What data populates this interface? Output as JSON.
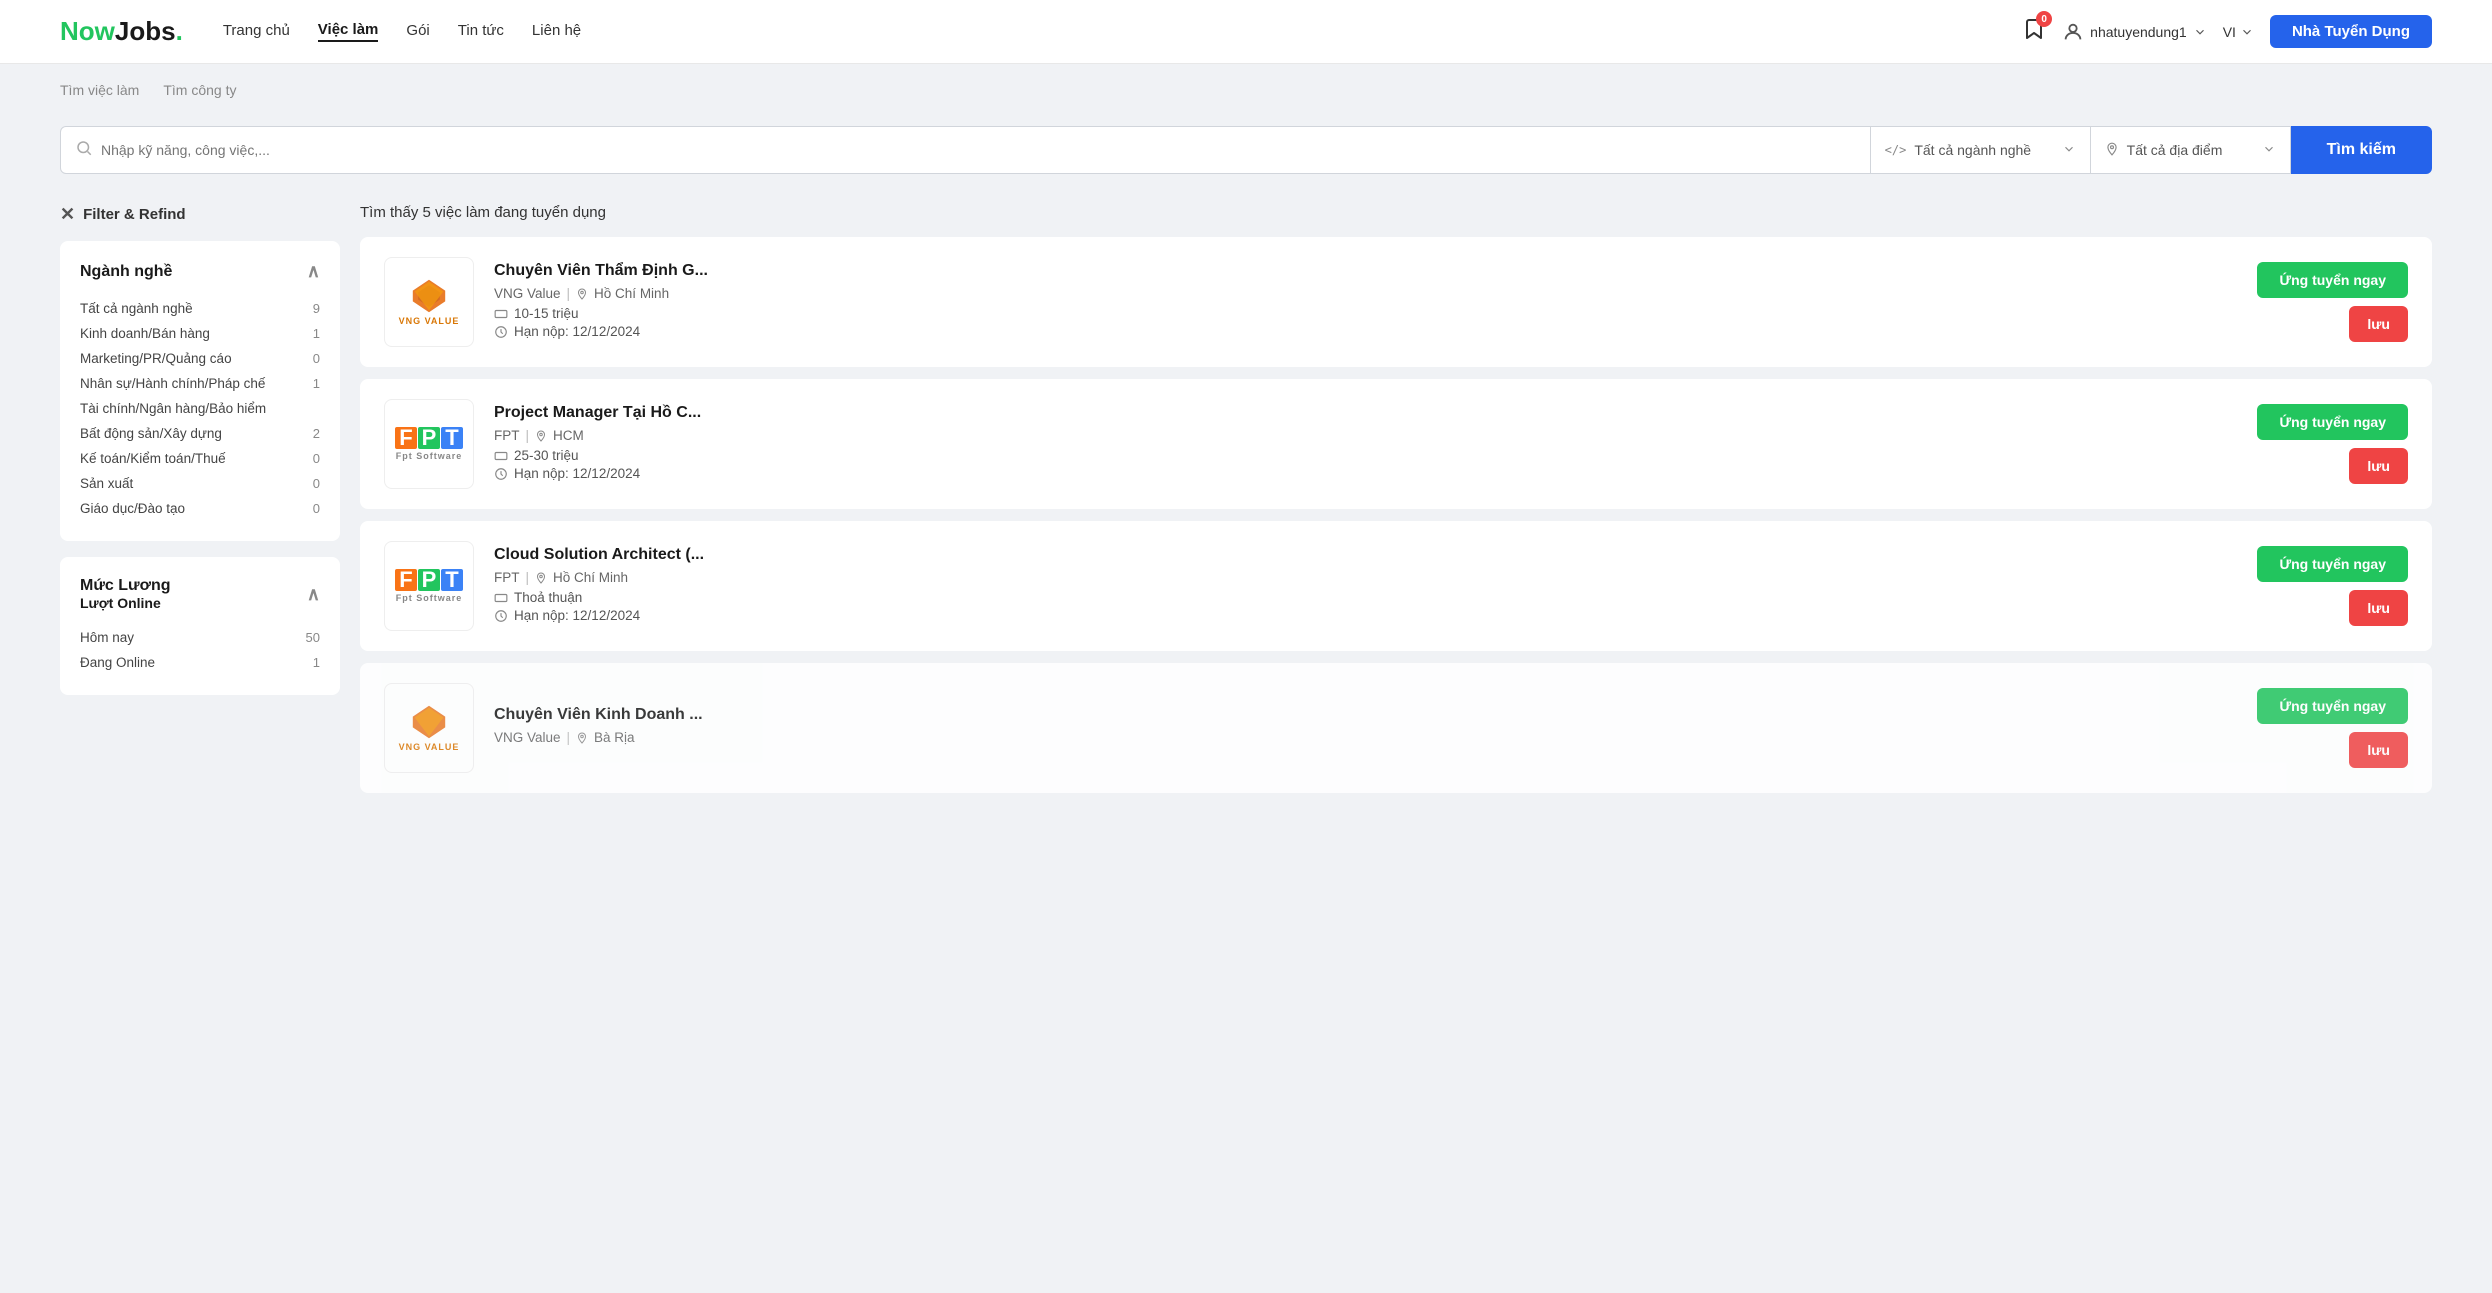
{
  "header": {
    "logo_now": "Now",
    "logo_jobs": "Jobs",
    "logo_dot": ".",
    "nav": [
      {
        "label": "Trang chủ",
        "active": false
      },
      {
        "label": "Việc làm",
        "active": true
      },
      {
        "label": "Gói",
        "active": false
      },
      {
        "label": "Tin tức",
        "active": false
      },
      {
        "label": "Liên hệ",
        "active": false
      }
    ],
    "badge_count": "0",
    "user_name": "nhatuyendung1",
    "lang": "VI",
    "btn_employer": "Nhà Tuyển Dụng"
  },
  "subnav": [
    {
      "label": "Tìm việc làm",
      "active": true
    },
    {
      "label": "Tìm công ty",
      "active": false
    }
  ],
  "search": {
    "input_placeholder": "Nhập kỹ năng, công việc,...",
    "industry_label": "Tất cả ngành nghề",
    "location_label": "Tất cả địa điểm",
    "btn_label": "Tìm kiếm"
  },
  "filter": {
    "title": "Filter & Refind",
    "industry_section": {
      "title": "Ngành nghề",
      "items": [
        {
          "label": "Tất cả ngành nghề",
          "count": "9"
        },
        {
          "label": "Kinh doanh/Bán hàng",
          "count": "1"
        },
        {
          "label": "Marketing/PR/Quảng cáo",
          "count": "0"
        },
        {
          "label": "Nhân sự/Hành chính/Pháp chế",
          "count": "1"
        },
        {
          "label": "Tài chính/Ngân hàng/Bảo hiểm",
          "count": ""
        },
        {
          "label": "Bất động sản/Xây dựng",
          "count": "2"
        },
        {
          "label": "Kế toán/Kiểm toán/Thuế",
          "count": "0"
        },
        {
          "label": "Sản xuất",
          "count": "0"
        },
        {
          "label": "Giáo dục/Đào tạo",
          "count": "0"
        }
      ]
    },
    "salary_section": {
      "title": "Mức Lương",
      "subtitle": "Lượt Online",
      "items": [
        {
          "label": "Hôm nay",
          "count": "50"
        },
        {
          "label": "Đang Online",
          "count": "1"
        }
      ]
    }
  },
  "jobs": {
    "count_text": "Tìm thấy 5 việc làm đang tuyển dụng",
    "list": [
      {
        "id": 1,
        "title": "Chuyên Viên Thẩm Định G...",
        "company": "VNG Value",
        "location": "Hồ Chí Minh",
        "salary": "10-15 triệu",
        "deadline": "Hạn nộp: 12/12/2024",
        "logo_type": "vng",
        "btn_apply": "Ứng tuyển ngay",
        "btn_save": "lưu"
      },
      {
        "id": 2,
        "title": "Project Manager Tại Hồ C...",
        "company": "FPT",
        "location": "HCM",
        "salary": "25-30 triệu",
        "deadline": "Hạn nộp: 12/12/2024",
        "logo_type": "fpt",
        "btn_apply": "Ứng tuyển ngay",
        "btn_save": "lưu"
      },
      {
        "id": 3,
        "title": "Cloud Solution Architect (...",
        "company": "FPT",
        "location": "Hồ Chí Minh",
        "salary": "Thoả thuận",
        "deadline": "Hạn nộp: 12/12/2024",
        "logo_type": "fpt",
        "btn_apply": "Ứng tuyển ngay",
        "btn_save": "lưu"
      },
      {
        "id": 4,
        "title": "Chuyên Viên Kinh Doanh ...",
        "company": "VNG Value",
        "location": "Bà Rịa",
        "salary": "",
        "deadline": "",
        "logo_type": "vng",
        "btn_apply": "Ứng tuyển ngay",
        "btn_save": "lưu"
      }
    ]
  }
}
